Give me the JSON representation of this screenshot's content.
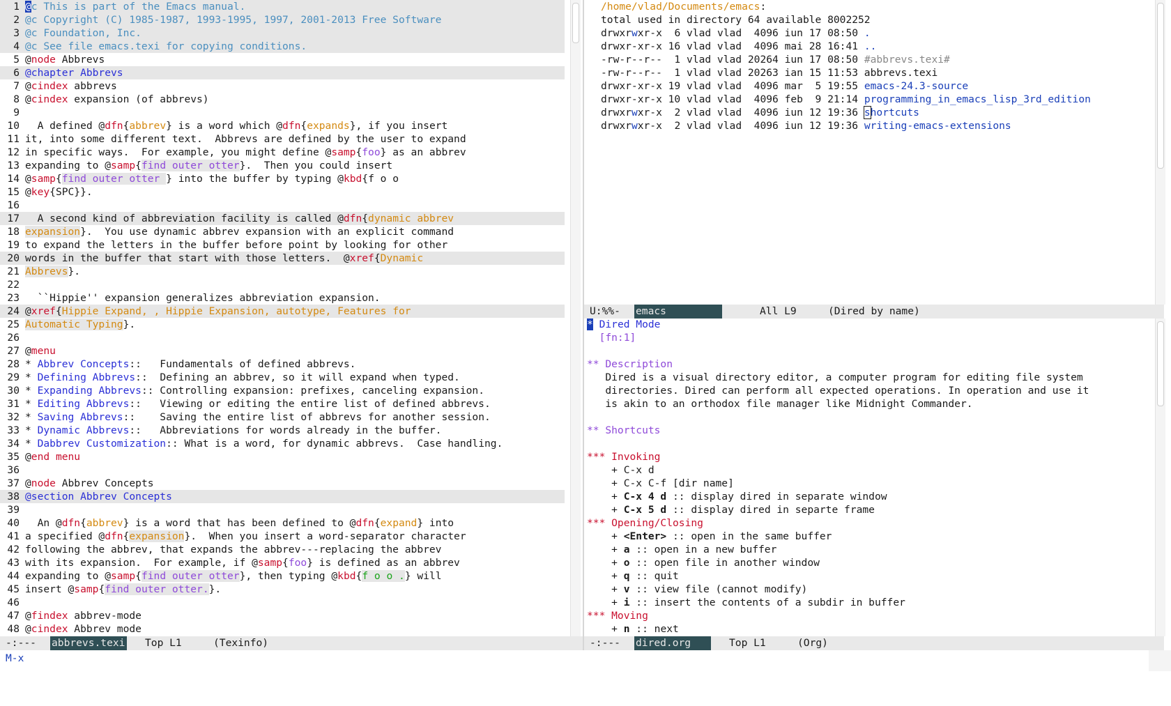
{
  "left_buffer": {
    "lines": [
      {
        "n": "1",
        "hl": true,
        "s": [
          {
            "t": "@",
            "c": "cursor"
          },
          {
            "t": "c This is part of the Emacs manual.",
            "c": "cm"
          }
        ]
      },
      {
        "n": "2",
        "hl": true,
        "s": [
          {
            "t": "@c Copyright (C) 1985-1987, 1993-1995, 1997, 2001-2013 Free Software",
            "c": "cm"
          }
        ]
      },
      {
        "n": "3",
        "hl": true,
        "s": [
          {
            "t": "@c Foundation, Inc.",
            "c": "cm"
          }
        ]
      },
      {
        "n": "4",
        "hl": true,
        "s": [
          {
            "t": "@c See file emacs.texi for copying conditions.",
            "c": "cm"
          }
        ]
      },
      {
        "n": "5",
        "s": [
          {
            "t": "@"
          },
          {
            "t": "node",
            "c": "red"
          },
          {
            "t": " Abbrevs"
          }
        ]
      },
      {
        "n": "6",
        "hl": true,
        "s": [
          {
            "t": "@chapter Abbrevs",
            "c": "kw"
          }
        ]
      },
      {
        "n": "7",
        "s": [
          {
            "t": "@"
          },
          {
            "t": "cindex",
            "c": "red"
          },
          {
            "t": " abbrevs"
          }
        ]
      },
      {
        "n": "8",
        "s": [
          {
            "t": "@"
          },
          {
            "t": "cindex",
            "c": "red"
          },
          {
            "t": " expansion (of abbrevs)"
          }
        ]
      },
      {
        "n": "9",
        "s": []
      },
      {
        "n": "10",
        "s": [
          {
            "t": "  A defined @"
          },
          {
            "t": "dfn",
            "c": "red"
          },
          {
            "t": "{"
          },
          {
            "t": "abbrev",
            "c": "org"
          },
          {
            "t": "} is a word which @"
          },
          {
            "t": "dfn",
            "c": "red"
          },
          {
            "t": "{"
          },
          {
            "t": "expands",
            "c": "org"
          },
          {
            "t": "}, if you insert"
          }
        ]
      },
      {
        "n": "11",
        "s": [
          {
            "t": "it, into some different text.  Abbrevs are defined by the user to expand"
          }
        ]
      },
      {
        "n": "12",
        "s": [
          {
            "t": "in specific ways.  For example, you might define @"
          },
          {
            "t": "samp",
            "c": "red"
          },
          {
            "t": "{"
          },
          {
            "t": "foo",
            "c": "purple"
          },
          {
            "t": "} as an abbrev"
          }
        ]
      },
      {
        "n": "13",
        "s": [
          {
            "t": "expanding to @"
          },
          {
            "t": "samp",
            "c": "red"
          },
          {
            "t": "{"
          },
          {
            "t": "find outer otter",
            "c": "purple",
            "b": true
          },
          {
            "t": "}.  Then you could insert"
          }
        ]
      },
      {
        "n": "14",
        "s": [
          {
            "t": "@"
          },
          {
            "t": "samp",
            "c": "red"
          },
          {
            "t": "{"
          },
          {
            "t": "find outer otter ",
            "c": "purple",
            "b": true
          },
          {
            "t": "} into the buffer by typing @"
          },
          {
            "t": "kbd",
            "c": "red"
          },
          {
            "t": "{f o o"
          }
        ]
      },
      {
        "n": "15",
        "s": [
          {
            "t": "@"
          },
          {
            "t": "key",
            "c": "red"
          },
          {
            "t": "{SPC}}."
          }
        ]
      },
      {
        "n": "16",
        "s": []
      },
      {
        "n": "17",
        "hl": true,
        "s": [
          {
            "t": "  A second kind of abbreviation facility is called @"
          },
          {
            "t": "dfn",
            "c": "red"
          },
          {
            "t": "{"
          },
          {
            "t": "dynamic abbrev",
            "c": "org"
          }
        ]
      },
      {
        "n": "18",
        "s": [
          {
            "t": "expansion",
            "c": "org",
            "b": true
          },
          {
            "t": "}.  You use dynamic abbrev expansion with an explicit command"
          }
        ]
      },
      {
        "n": "19",
        "s": [
          {
            "t": "to expand the letters in the buffer before point by looking for other"
          }
        ]
      },
      {
        "n": "20",
        "hl": true,
        "s": [
          {
            "t": "words in the buffer that start with those letters.  @"
          },
          {
            "t": "xref",
            "c": "red"
          },
          {
            "t": "{"
          },
          {
            "t": "Dynamic",
            "c": "org"
          }
        ]
      },
      {
        "n": "21",
        "s": [
          {
            "t": "Abbrevs",
            "c": "org",
            "b": true
          },
          {
            "t": "}."
          }
        ]
      },
      {
        "n": "22",
        "s": []
      },
      {
        "n": "23",
        "s": [
          {
            "t": "  ``Hippie'' expansion generalizes abbreviation expansion."
          }
        ]
      },
      {
        "n": "24",
        "hl": true,
        "s": [
          {
            "t": "@"
          },
          {
            "t": "xref",
            "c": "red"
          },
          {
            "t": "{"
          },
          {
            "t": "Hippie Expand, , Hippie Expansion, autotype, Features for",
            "c": "org"
          }
        ]
      },
      {
        "n": "25",
        "s": [
          {
            "t": "Automatic Typing",
            "c": "org",
            "b": true
          },
          {
            "t": "}."
          }
        ]
      },
      {
        "n": "26",
        "s": []
      },
      {
        "n": "27",
        "s": [
          {
            "t": "@"
          },
          {
            "t": "menu",
            "c": "red"
          }
        ]
      },
      {
        "n": "28",
        "s": [
          {
            "t": "* "
          },
          {
            "t": "Abbrev Concepts",
            "c": "kw"
          },
          {
            "t": "::   Fundamentals of defined abbrevs."
          }
        ]
      },
      {
        "n": "29",
        "s": [
          {
            "t": "* "
          },
          {
            "t": "Defining Abbrevs",
            "c": "kw"
          },
          {
            "t": "::  Defining an abbrev, so it will expand when typed."
          }
        ]
      },
      {
        "n": "30",
        "s": [
          {
            "t": "* "
          },
          {
            "t": "Expanding Abbrevs",
            "c": "kw"
          },
          {
            "t": ":: Controlling expansion: prefixes, canceling expansion."
          }
        ]
      },
      {
        "n": "31",
        "s": [
          {
            "t": "* "
          },
          {
            "t": "Editing Abbrevs",
            "c": "kw"
          },
          {
            "t": "::   Viewing or editing the entire list of defined abbrevs."
          }
        ]
      },
      {
        "n": "32",
        "s": [
          {
            "t": "* "
          },
          {
            "t": "Saving Abbrevs",
            "c": "kw"
          },
          {
            "t": "::    Saving the entire list of abbrevs for another session."
          }
        ]
      },
      {
        "n": "33",
        "s": [
          {
            "t": "* "
          },
          {
            "t": "Dynamic Abbrevs",
            "c": "kw"
          },
          {
            "t": "::   Abbreviations for words already in the buffer."
          }
        ]
      },
      {
        "n": "34",
        "s": [
          {
            "t": "* "
          },
          {
            "t": "Dabbrev Customization",
            "c": "kw"
          },
          {
            "t": ":: What is a word, for dynamic abbrevs.  Case handling."
          }
        ]
      },
      {
        "n": "35",
        "s": [
          {
            "t": "@"
          },
          {
            "t": "end menu",
            "c": "red"
          }
        ]
      },
      {
        "n": "36",
        "s": []
      },
      {
        "n": "37",
        "s": [
          {
            "t": "@"
          },
          {
            "t": "node",
            "c": "red"
          },
          {
            "t": " Abbrev Concepts"
          }
        ]
      },
      {
        "n": "38",
        "hl": true,
        "s": [
          {
            "t": "@section Abbrev Concepts",
            "c": "kw"
          }
        ]
      },
      {
        "n": "39",
        "s": []
      },
      {
        "n": "40",
        "s": [
          {
            "t": "  An @"
          },
          {
            "t": "dfn",
            "c": "red"
          },
          {
            "t": "{"
          },
          {
            "t": "abbrev",
            "c": "org"
          },
          {
            "t": "} is a word that has been defined to @"
          },
          {
            "t": "dfn",
            "c": "red"
          },
          {
            "t": "{"
          },
          {
            "t": "expand",
            "c": "org"
          },
          {
            "t": "} into"
          }
        ]
      },
      {
        "n": "41",
        "s": [
          {
            "t": "a specified @"
          },
          {
            "t": "dfn",
            "c": "red"
          },
          {
            "t": "{"
          },
          {
            "t": "expansion",
            "c": "org",
            "b": true
          },
          {
            "t": "}.  When you insert a word-separator character"
          }
        ]
      },
      {
        "n": "42",
        "s": [
          {
            "t": "following the abbrev, that expands the abbrev---replacing the abbrev"
          }
        ]
      },
      {
        "n": "43",
        "s": [
          {
            "t": "with its expansion.  For example, if @"
          },
          {
            "t": "samp",
            "c": "red"
          },
          {
            "t": "{"
          },
          {
            "t": "foo",
            "c": "purple"
          },
          {
            "t": "} is defined as an abbrev"
          }
        ]
      },
      {
        "n": "44",
        "s": [
          {
            "t": "expanding to @"
          },
          {
            "t": "samp",
            "c": "red"
          },
          {
            "t": "{"
          },
          {
            "t": "find outer otter",
            "c": "purple",
            "b": true
          },
          {
            "t": "}, then typing @"
          },
          {
            "t": "kbd",
            "c": "red"
          },
          {
            "t": "{"
          },
          {
            "t": "f o o .",
            "c": "green",
            "b": true
          },
          {
            "t": "} will"
          }
        ]
      },
      {
        "n": "45",
        "s": [
          {
            "t": "insert @"
          },
          {
            "t": "samp",
            "c": "red"
          },
          {
            "t": "{"
          },
          {
            "t": "find outer otter.",
            "c": "purple",
            "b": true
          },
          {
            "t": "}."
          }
        ]
      },
      {
        "n": "46",
        "s": []
      },
      {
        "n": "47",
        "s": [
          {
            "t": "@"
          },
          {
            "t": "findex",
            "c": "red"
          },
          {
            "t": " abbrev-mode"
          }
        ]
      },
      {
        "n": "48",
        "s": [
          {
            "t": "@"
          },
          {
            "t": "cindex",
            "c": "red"
          },
          {
            "t": " Abbrev mode"
          }
        ]
      }
    ],
    "modeline": {
      "status": "-:---",
      "buffer": "abbrevs.texi",
      "position": "Top L1",
      "mode": "(Texinfo)"
    }
  },
  "dired_buffer": {
    "lines": [
      {
        "s": [
          {
            "t": "/home/vlad/Documents/emacs",
            "c": "org"
          },
          {
            "t": ":"
          }
        ]
      },
      {
        "s": [
          {
            "t": "total used in directory 64 available 8002252"
          }
        ]
      },
      {
        "s": [
          {
            "t": "drwxr"
          },
          {
            "t": "w",
            "c": "blue"
          },
          {
            "t": "xr-x  6 vlad vlad  4096 iun 17 08:50 "
          },
          {
            "t": ".",
            "c": "blue"
          }
        ]
      },
      {
        "s": [
          {
            "t": "drwxr-xr-x 16 vlad vlad  4096 mai 28 16:41 "
          },
          {
            "t": "..",
            "c": "blue"
          }
        ]
      },
      {
        "s": [
          {
            "t": "-rw-r--r--  1 vlad vlad 20264 iun 17 08:50 "
          },
          {
            "t": "#abbrevs.texi#",
            "c": "dim"
          }
        ]
      },
      {
        "s": [
          {
            "t": "-rw-r--r--  1 vlad vlad 20263 ian 15 11:53 abbrevs.texi"
          }
        ]
      },
      {
        "s": [
          {
            "t": "drwxr-xr-x 19 vlad vlad  4096 mar  5 19:55 "
          },
          {
            "t": "emacs-24.3-source",
            "c": "blue"
          }
        ]
      },
      {
        "s": [
          {
            "t": "drwxr-xr-x 10 vlad vlad  4096 feb  9 21:14 "
          },
          {
            "t": "programming_in_emacs_lisp_3rd_edition",
            "c": "blue"
          }
        ]
      },
      {
        "s": [
          {
            "t": "drwxr"
          },
          {
            "t": "w",
            "c": "blue"
          },
          {
            "t": "xr-x  2 vlad vlad  4096 iun 12 19:36 "
          },
          {
            "t": "s",
            "c": "cursor-hollow blue"
          },
          {
            "t": "hortcuts",
            "c": "blue"
          }
        ]
      },
      {
        "s": [
          {
            "t": "drwxr"
          },
          {
            "t": "w",
            "c": "blue"
          },
          {
            "t": "xr-x  2 vlad vlad  4096 iun 12 19:36 "
          },
          {
            "t": "writing-emacs-extensions",
            "c": "blue"
          }
        ]
      }
    ],
    "modeline": {
      "status": "U:%%-",
      "buffer": "emacs",
      "position": "All L9",
      "mode": "(Dired by name)"
    }
  },
  "org_buffer": {
    "lines": [
      {
        "s": [
          {
            "t": "*",
            "c": "cursor"
          },
          {
            "t": " Dired Mode",
            "c": "kw"
          }
        ]
      },
      {
        "s": [
          {
            "t": "  "
          },
          {
            "t": "[fn:1]",
            "c": "purple"
          }
        ]
      },
      {
        "s": []
      },
      {
        "s": [
          {
            "t": "** Description",
            "c": "purple"
          }
        ]
      },
      {
        "s": [
          {
            "t": "   Dired is a visual directory editor, a computer program for editing file system"
          }
        ]
      },
      {
        "s": [
          {
            "t": "   directories. Dired can perform all expected operations. In operation and use it"
          }
        ]
      },
      {
        "s": [
          {
            "t": "   is akin to an orthodox file manager like Midnight Commander."
          }
        ]
      },
      {
        "s": []
      },
      {
        "s": [
          {
            "t": "** Shortcuts ",
            "c": "purple"
          }
        ]
      },
      {
        "s": []
      },
      {
        "s": [
          {
            "t": "*** Invoking",
            "c": "red"
          }
        ]
      },
      {
        "s": [
          {
            "t": "    + C-x d"
          }
        ]
      },
      {
        "s": [
          {
            "t": "    + C-x C-f [dir name]"
          }
        ]
      },
      {
        "s": [
          {
            "t": "    + "
          },
          {
            "t": "C-x 4 d",
            "c": "bold"
          },
          {
            "t": " :: display dired in separate window"
          }
        ]
      },
      {
        "s": [
          {
            "t": "    + "
          },
          {
            "t": "C-x 5 d",
            "c": "bold"
          },
          {
            "t": " :: display dired in separte frame"
          }
        ]
      },
      {
        "s": [
          {
            "t": "*** Opening/Closing",
            "c": "red"
          }
        ]
      },
      {
        "s": [
          {
            "t": "    + "
          },
          {
            "t": "<Enter>",
            "c": "bold"
          },
          {
            "t": " :: open in the same buffer"
          }
        ]
      },
      {
        "s": [
          {
            "t": "    + "
          },
          {
            "t": "a",
            "c": "bold"
          },
          {
            "t": " :: open in a new buffer"
          }
        ]
      },
      {
        "s": [
          {
            "t": "    + "
          },
          {
            "t": "o",
            "c": "bold"
          },
          {
            "t": " :: open file in another window"
          }
        ]
      },
      {
        "s": [
          {
            "t": "    + "
          },
          {
            "t": "q",
            "c": "bold"
          },
          {
            "t": " :: quit"
          }
        ]
      },
      {
        "s": [
          {
            "t": "    + "
          },
          {
            "t": "v",
            "c": "bold"
          },
          {
            "t": " :: view file (cannot modify)"
          }
        ]
      },
      {
        "s": [
          {
            "t": "    + "
          },
          {
            "t": "i",
            "c": "bold"
          },
          {
            "t": " :: insert the contents of a subdir in buffer"
          }
        ]
      },
      {
        "s": [
          {
            "t": "*** Moving",
            "c": "red"
          }
        ]
      },
      {
        "s": [
          {
            "t": "    + "
          },
          {
            "t": "n",
            "c": "bold"
          },
          {
            "t": " :: next"
          }
        ]
      }
    ],
    "modeline": {
      "status": "-:---",
      "buffer": "dired.org",
      "position": "Top L1",
      "mode": "(Org)"
    }
  },
  "minibuffer": {
    "text": "M-x"
  },
  "colors": {
    "modeline_bg": "#e9e9e9",
    "buffer_name_bg": "#2f4f55",
    "line_highlight": "#e6e6e6"
  }
}
